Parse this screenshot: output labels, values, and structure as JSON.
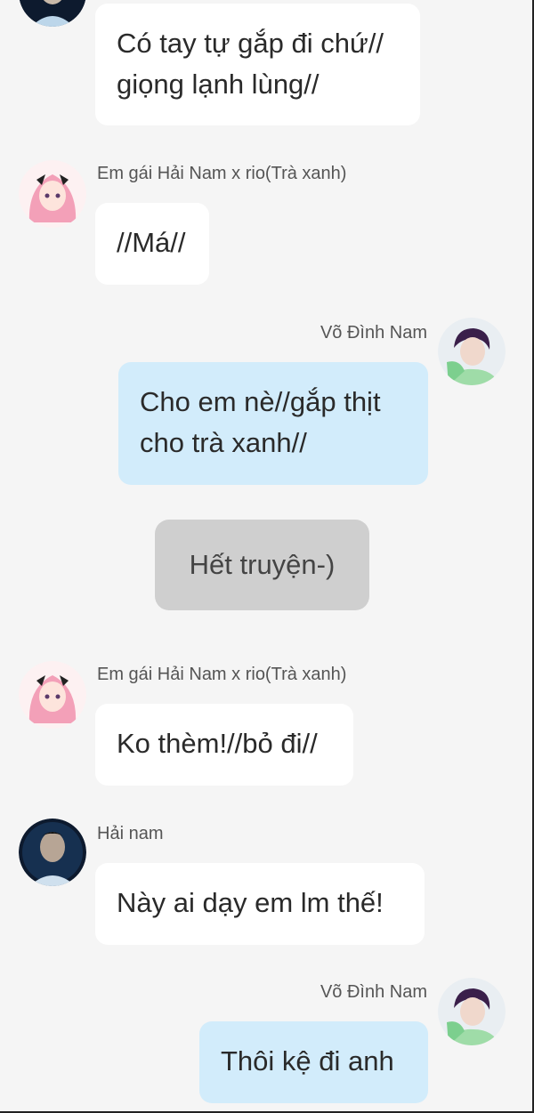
{
  "messages": [
    {
      "lines": [
        "Có tay tự gắp đi chứ//",
        "giọng lạnh lùng//"
      ]
    },
    {
      "sender": "Em gái Hải Nam x rio(Trà xanh)",
      "lines": [
        "//Má//"
      ]
    },
    {
      "sender": "Võ Đình Nam",
      "lines": [
        "Cho em nè//gắp thịt",
        "cho trà xanh//"
      ]
    },
    {
      "lines": [
        "Hết truyện-)"
      ]
    },
    {
      "sender": "Em gái Hải Nam x rio(Trà xanh)",
      "lines": [
        "Ko thèm!//bỏ đi//"
      ]
    },
    {
      "sender": "Hải nam",
      "lines": [
        "Này ai dạy em lm thế!"
      ]
    },
    {
      "sender": "Võ Đình Nam",
      "lines": [
        "Thôi kệ đi anh"
      ]
    }
  ]
}
